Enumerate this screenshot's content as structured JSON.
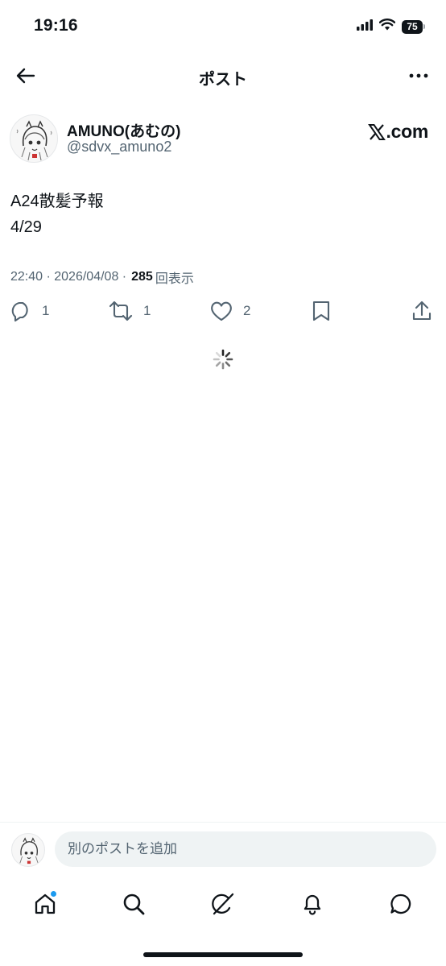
{
  "status_bar": {
    "time": "19:16",
    "battery": "75"
  },
  "header": {
    "title": "ポスト"
  },
  "author": {
    "display_name": "AMUNO(あむの)",
    "handle": "@sdvx_amuno2"
  },
  "source_badge": {
    "text": ".com"
  },
  "post": {
    "lines": [
      "A24散髪予報",
      "4/29"
    ],
    "timestamp": "22:40 · 2026/04/08 · ",
    "views": "285",
    "views_label": "回表示"
  },
  "actions": {
    "reply_count": "1",
    "repost_count": "1",
    "like_count": "2"
  },
  "composer": {
    "placeholder": "別のポストを追加"
  },
  "tabs": [
    "home-tab",
    "search-tab",
    "grok-tab",
    "notifications-tab",
    "messages-tab"
  ],
  "colors": {
    "text": "#0f1419",
    "secondary": "#536471",
    "accent": "#1d9bf0",
    "input_bg": "#eff3f4"
  }
}
